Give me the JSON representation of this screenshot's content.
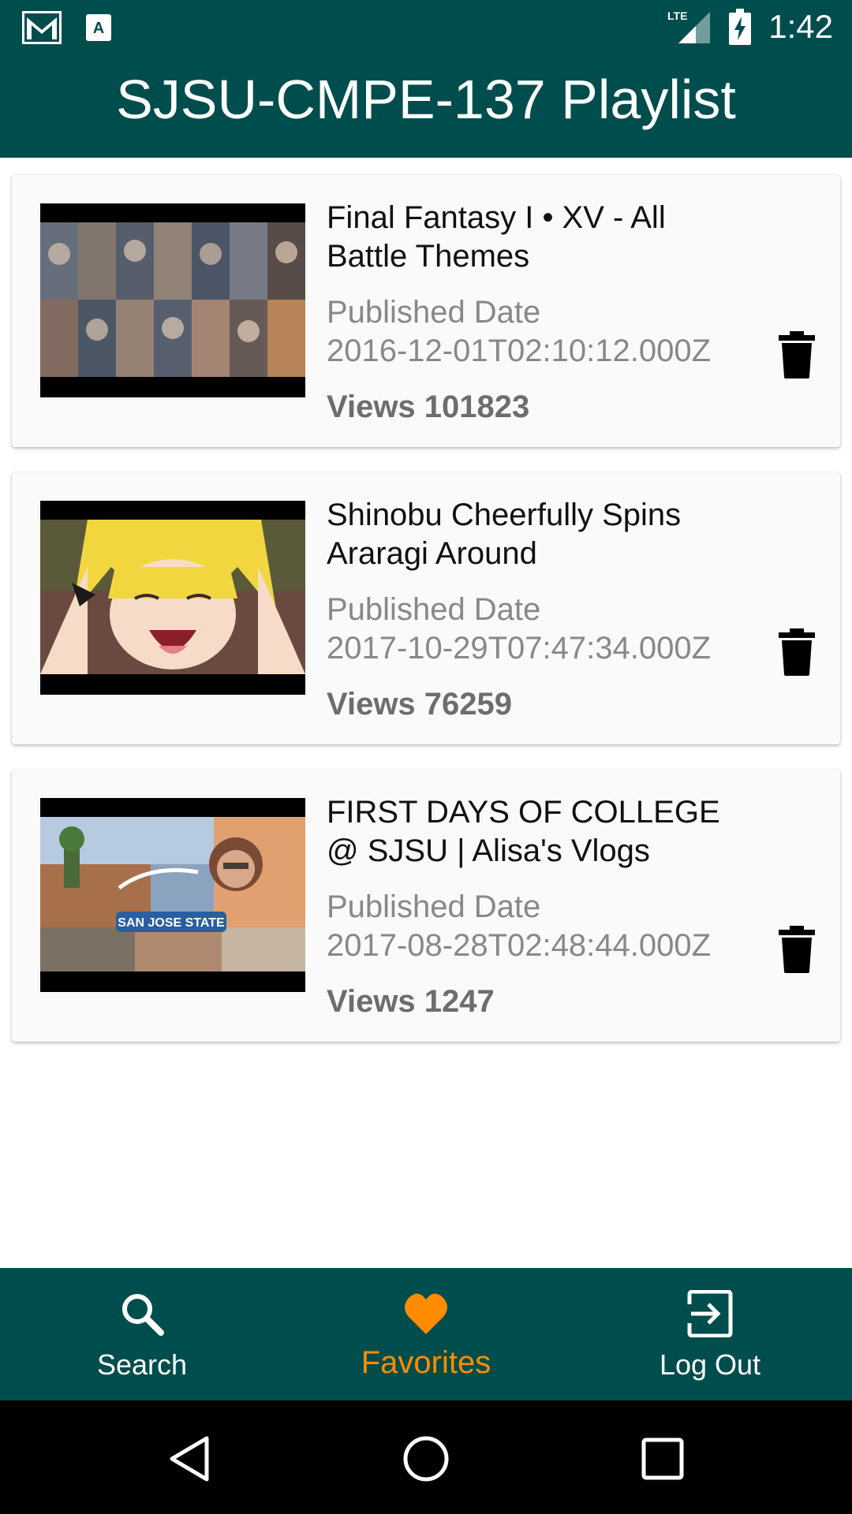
{
  "status_bar": {
    "icons_left": [
      "gmail-icon",
      "app-notification-icon"
    ],
    "network": "LTE",
    "time": "1:42"
  },
  "app_bar": {
    "title": "SJSU-CMPE-137 Playlist"
  },
  "videos": [
    {
      "title": "Final Fantasy I • XV - All Battle Themes",
      "published_label": "Published Date",
      "published_date": "2016-12-01T02:10:12.000Z",
      "views": "Views 101823"
    },
    {
      "title": "Shinobu Cheerfully Spins Araragi Around",
      "published_label": "Published Date",
      "published_date": "2017-10-29T07:47:34.000Z",
      "views": "Views 76259"
    },
    {
      "title": "FIRST DAYS OF COLLEGE @ SJSU | Alisa's Vlogs",
      "published_label": "Published Date",
      "published_date": "2017-08-28T02:48:44.000Z",
      "views": "Views 1247"
    }
  ],
  "bottom_nav": {
    "items": [
      {
        "label": "Search",
        "icon": "search-icon",
        "active": false
      },
      {
        "label": "Favorites",
        "icon": "heart-icon",
        "active": true
      },
      {
        "label": "Log Out",
        "icon": "logout-icon",
        "active": false
      }
    ]
  },
  "colors": {
    "primary": "#004d4d",
    "accent": "#ff8c00",
    "card_bg": "#fafafa"
  }
}
